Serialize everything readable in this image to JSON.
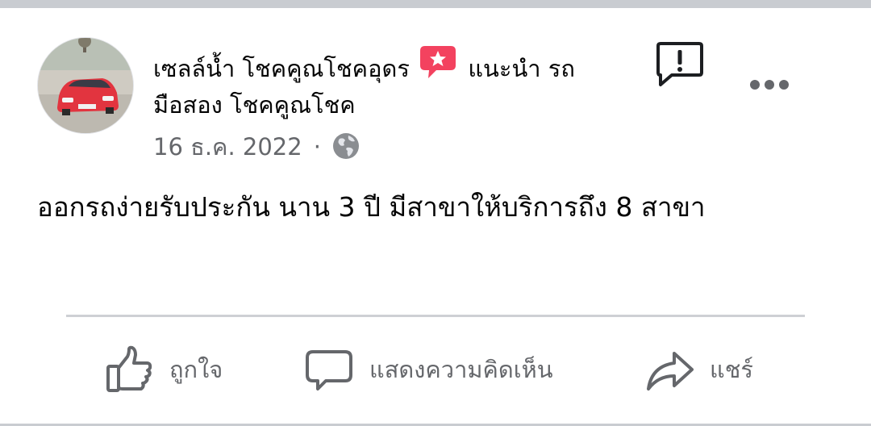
{
  "post": {
    "author_line_1": "เซลล์น้ำ โชคคูณโชคอุดร",
    "badge_label": "แนะนำ รถ",
    "author_line_2": "มือสอง โชคคูณโชค",
    "date": "16 ธ.ค. 2022",
    "separator": "·",
    "privacy_icon": "globe-icon",
    "text": "ออกรถง่ายรับประกัน นาน 3 ปี  มีสาขาให้บริการถึง 8 สาขา"
  },
  "actions": {
    "like_label": "ถูกใจ",
    "comment_label": "แสดงความคิดเห็น",
    "share_label": "แชร์"
  },
  "icons": {
    "badge": "star-badge-icon",
    "report": "report-icon",
    "more": "more-options-icon"
  },
  "colors": {
    "badge": "#f3425f",
    "secondary_text": "#65676b",
    "divider": "#ced0d4"
  }
}
